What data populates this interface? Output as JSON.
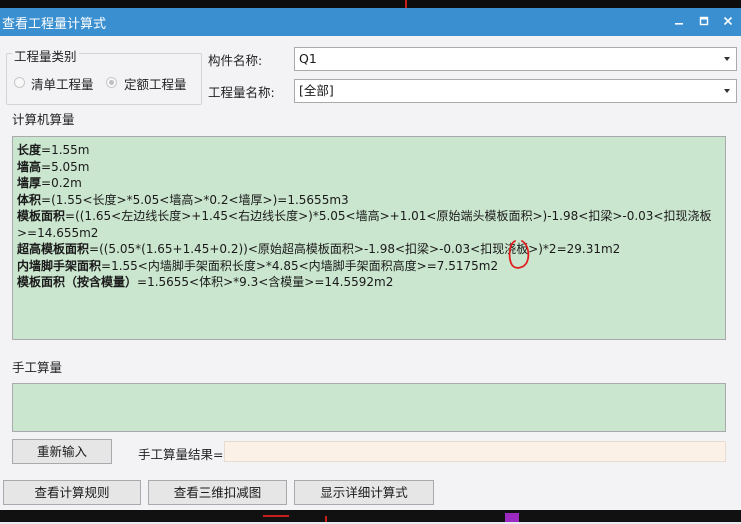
{
  "window": {
    "title": "查看工程量计算式"
  },
  "quantity_type": {
    "group_label": "工程量类别",
    "options": [
      {
        "label": "清单工程量",
        "checked": false
      },
      {
        "label": "定额工程量",
        "checked": true
      }
    ]
  },
  "component": {
    "label": "构件名称:",
    "value": "Q1"
  },
  "quantity_name": {
    "label": "工程量名称:",
    "value": "[全部]"
  },
  "computer_calc": {
    "group_label": "计算机算量",
    "lines": [
      {
        "label": "长度",
        "expr": "=1.55m"
      },
      {
        "label": "墙高",
        "expr": "=5.05m"
      },
      {
        "label": "墙厚",
        "expr": "=0.2m"
      },
      {
        "label": "体积",
        "expr": "=(1.55<长度>*5.05<墙高>*0.2<墙厚>)=1.5655m3"
      },
      {
        "label": "模板面积",
        "expr": "=((1.65<左边线长度>+1.45<右边线长度>)*5.05<墙高>+1.01<原始端头模板面积>)-1.98<扣梁>-0.03<扣现浇板>=14.655m2"
      },
      {
        "label": "超高模板面积",
        "expr": "=((5.05*(1.65+1.45+0.2))<原始超高模板面积>-1.98<扣梁>-0.03<扣现浇板>)*2=29.31m2"
      },
      {
        "label": "内墙脚手架面积",
        "expr": "=1.55<内墙脚手架面积长度>*4.85<内墙脚手架面积高度>=7.5175m2"
      },
      {
        "label": "模板面积（按含模量）",
        "expr": "=1.5655<体积>*9.3<含模量>=14.5592m2"
      }
    ]
  },
  "manual_calc": {
    "group_label": "手工算量",
    "reenter_label": "重新输入",
    "result_label": "手工算量结果=",
    "result_value": ""
  },
  "footer_buttons": {
    "rules": "查看计算规则",
    "3d": "查看三维扣减图",
    "detail": "显示详细计算式"
  },
  "colors": {
    "titlebar": "#3a8fd0",
    "calc_bg": "#cbe6cf",
    "annotation": "#e02020"
  }
}
